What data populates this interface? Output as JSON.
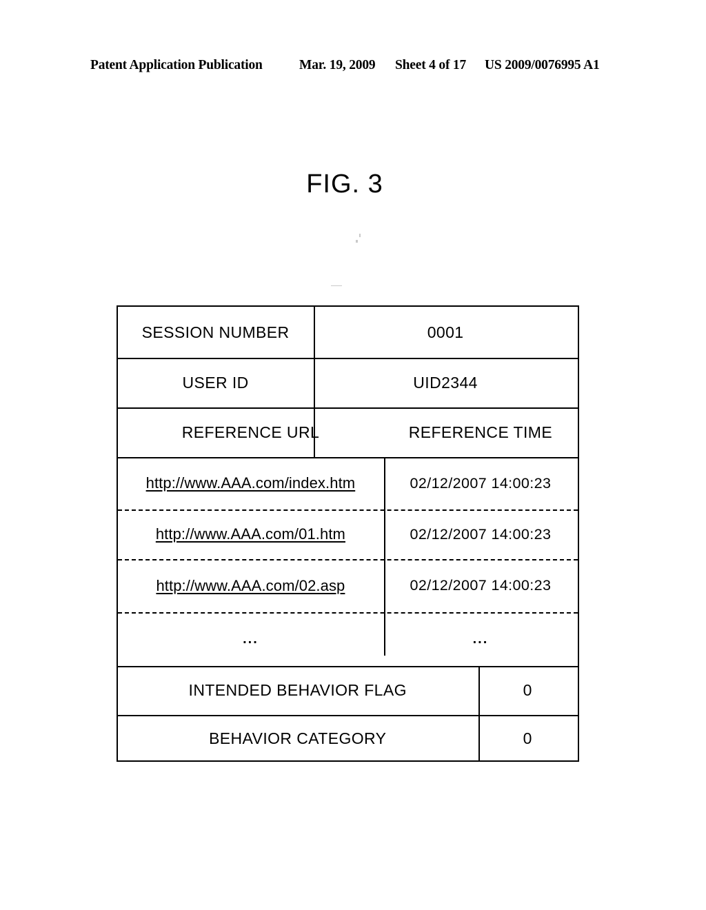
{
  "page_header": {
    "publication": "Patent Application Publication",
    "date": "Mar. 19, 2009",
    "sheet": "Sheet 4 of 17",
    "document_number": "US 2009/0076995 A1"
  },
  "figure": {
    "title": "FIG. 3"
  },
  "table": {
    "session_number_label": "SESSION NUMBER",
    "session_number_value": "0001",
    "user_id_label": "USER ID",
    "user_id_value": "UID2344",
    "reference_url_header": "REFERENCE URL",
    "reference_time_header": "REFERENCE TIME",
    "references": [
      {
        "url": "http://www.AAA.com/index.htm",
        "time": "02/12/2007 14:00:23"
      },
      {
        "url": "http://www.AAA.com/01.htm",
        "time": "02/12/2007 14:00:23"
      },
      {
        "url": "http://www.AAA.com/02.asp",
        "time": "02/12/2007 14:00:23"
      }
    ],
    "continuation_url": "...",
    "continuation_time": "...",
    "intended_behavior_flag_label": "INTENDED BEHAVIOR FLAG",
    "intended_behavior_flag_value": "0",
    "behavior_category_label": "BEHAVIOR CATEGORY",
    "behavior_category_value": "0"
  }
}
